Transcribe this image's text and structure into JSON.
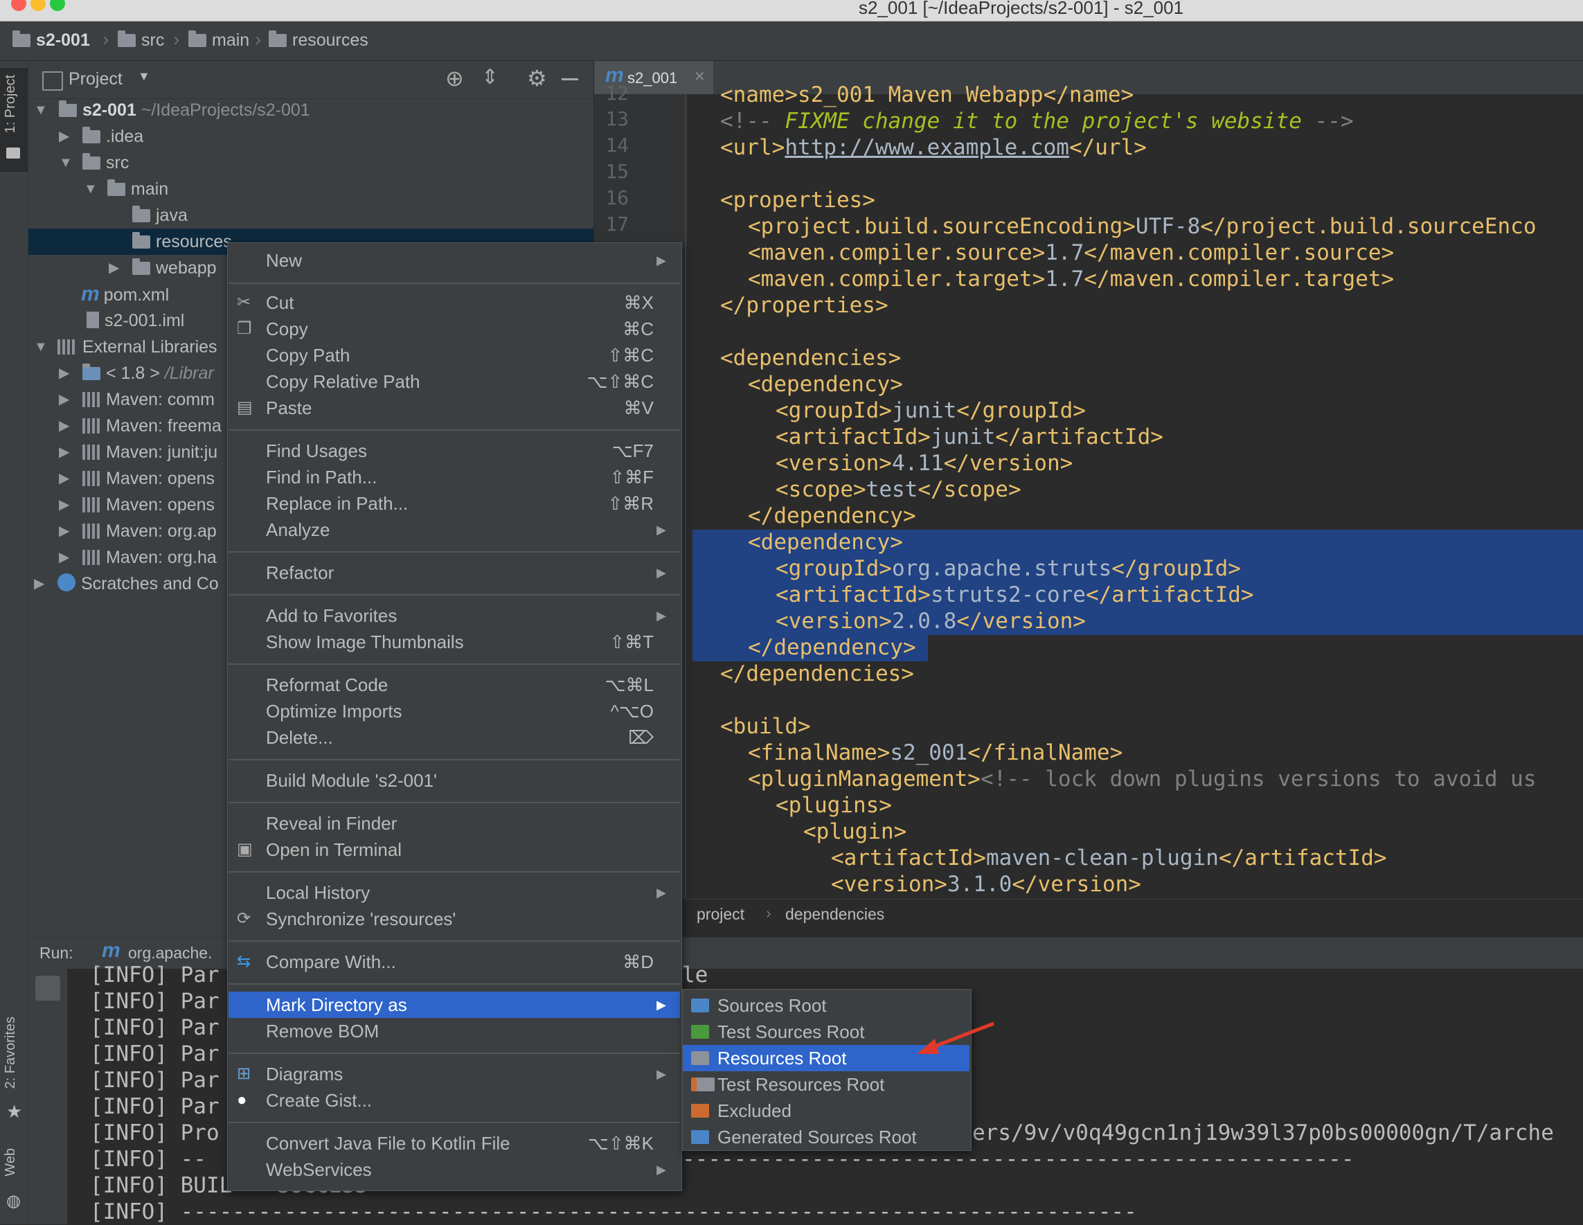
{
  "window": {
    "title": "s2_001 [~/IdeaProjects/s2-001] - s2_001"
  },
  "navbar": {
    "crumbs": [
      "s2-001",
      "src",
      "main",
      "resources"
    ]
  },
  "left_stripe": {
    "project_tab": "1: Project",
    "favorites_tab": "2: Favorites",
    "web_tab": "Web"
  },
  "project_panel": {
    "title": "Project",
    "tree": [
      {
        "label": "s2-001",
        "hint": "~/IdeaProjects/s2-001"
      },
      {
        "label": ".idea"
      },
      {
        "label": "src"
      },
      {
        "label": "main"
      },
      {
        "label": "java"
      },
      {
        "label": "resources"
      },
      {
        "label": "webapp"
      },
      {
        "label": "pom.xml"
      },
      {
        "label": "s2-001.iml"
      },
      {
        "label": "External Libraries"
      },
      {
        "label": "< 1.8 >",
        "hint": "/Librar"
      },
      {
        "label": "Maven: comm"
      },
      {
        "label": "Maven: freema"
      },
      {
        "label": "Maven: junit:ju"
      },
      {
        "label": "Maven: opens"
      },
      {
        "label": "Maven: opens"
      },
      {
        "label": "Maven: org.ap"
      },
      {
        "label": "Maven: org.ha"
      },
      {
        "label": "Scratches and Co"
      }
    ]
  },
  "editor": {
    "tab_label": "s2_001",
    "line_numbers": [
      "12",
      "13",
      "14",
      "15",
      "16",
      "17"
    ],
    "code_lines": {
      "l0": "<name>s2_001 Maven Webapp</name>",
      "l1_open": "<!-- ",
      "l1_fixme": "FIXME change it to the project's website",
      "l1_close": " -->",
      "l2_open": "<url>",
      "l2_link": "http://www.example.com",
      "l2_close": "</url>",
      "l4": "<properties>",
      "l5_tag": "<project.build.sourceEncoding>",
      "l5_val": "UTF-8",
      "l5_end": "</project.build.sourceEnco",
      "l6_tag": "<maven.compiler.source>",
      "l6_val": "1.7",
      "l6_end": "</maven.compiler.source>",
      "l7_tag": "<maven.compiler.target>",
      "l7_val": "1.7",
      "l7_end": "</maven.compiler.target>",
      "l8": "</properties>",
      "l10": "<dependencies>",
      "l11": "<dependency>",
      "l12_tag": "<groupId>",
      "l12_val": "junit",
      "l12_end": "</groupId>",
      "l13_tag": "<artifactId>",
      "l13_val": "junit",
      "l13_end": "</artifactId>",
      "l14_tag": "<version>",
      "l14_val": "4.11",
      "l14_end": "</version>",
      "l15_tag": "<scope>",
      "l15_val": "test",
      "l15_end": "</scope>",
      "l16": "</dependency>",
      "l17": "<dependency>",
      "l18_tag": "<groupId>",
      "l18_val": "org.apache.struts",
      "l18_end": "</groupId>",
      "l19_tag": "<artifactId>",
      "l19_val": "struts2-core",
      "l19_end": "</artifactId>",
      "l20_tag": "<version>",
      "l20_val": "2.0.8",
      "l20_end": "</version>",
      "l21": "</dependency>",
      "l22": "</dependencies>",
      "l24": "<build>",
      "l25_tag": "<finalName>",
      "l25_val": "s2_001",
      "l25_end": "</finalName>",
      "l26_tag": "<pluginManagement>",
      "l26_comment": "<!-- lock down plugins versions to avoid us",
      "l27": "<plugins>",
      "l28": "<plugin>",
      "l29_tag": "<artifactId>",
      "l29_val": "maven-clean-plugin",
      "l29_end": "</artifactId>",
      "l30_tag": "<version>",
      "l30_val": "3.1.0",
      "l30_end": "</version>"
    },
    "breadcrumb": [
      "project",
      "dependencies"
    ]
  },
  "run_panel": {
    "label": "Run:",
    "config": "org.apache.",
    "output": [
      "[INFO] Par",
      "[INFO] Par",
      "[INFO] Par",
      "[INFO] Par",
      "[INFO] Par",
      "[INFO] Par",
      "[INFO] Pro",
      "[INFO] --",
      "[INFO] BUIL",
      "[INFO] --------------------------------------------------------------------------"
    ],
    "output_tail_1": "le",
    "output_tail_2": "ers/9v/v0q49gcn1nj19w39l37p0bs00000gn/T/arche",
    "output_tail_3": "----------------------------------------------------",
    "output_tail_4": "SUCCESS"
  },
  "context_menu": {
    "items": [
      {
        "label": "New",
        "submenu": true
      },
      {
        "label": "Cut",
        "shortcut": "⌘X",
        "icon": "scissors-icon"
      },
      {
        "label": "Copy",
        "shortcut": "⌘C",
        "icon": "copy-icon"
      },
      {
        "label": "Copy Path",
        "shortcut": "⇧⌘C"
      },
      {
        "label": "Copy Relative Path",
        "shortcut": "⌥⇧⌘C"
      },
      {
        "label": "Paste",
        "shortcut": "⌘V",
        "icon": "paste-icon"
      },
      {
        "label": "Find Usages",
        "shortcut": "⌥F7"
      },
      {
        "label": "Find in Path...",
        "shortcut": "⇧⌘F"
      },
      {
        "label": "Replace in Path...",
        "shortcut": "⇧⌘R"
      },
      {
        "label": "Analyze",
        "submenu": true
      },
      {
        "label": "Refactor",
        "submenu": true
      },
      {
        "label": "Add to Favorites",
        "submenu": true
      },
      {
        "label": "Show Image Thumbnails",
        "shortcut": "⇧⌘T"
      },
      {
        "label": "Reformat Code",
        "shortcut": "⌥⌘L"
      },
      {
        "label": "Optimize Imports",
        "shortcut": "^⌥O"
      },
      {
        "label": "Delete...",
        "shortcut": "⌦"
      },
      {
        "label": "Build Module 's2-001'"
      },
      {
        "label": "Reveal in Finder"
      },
      {
        "label": "Open in Terminal",
        "icon": "terminal-icon"
      },
      {
        "label": "Local History",
        "submenu": true
      },
      {
        "label": "Synchronize 'resources'",
        "icon": "sync-icon"
      },
      {
        "label": "Compare With...",
        "shortcut": "⌘D",
        "icon": "compare-icon"
      },
      {
        "label": "Mark Directory as",
        "submenu": true,
        "highlighted": true
      },
      {
        "label": "Remove BOM"
      },
      {
        "label": "Diagrams",
        "submenu": true,
        "icon": "diagram-icon"
      },
      {
        "label": "Create Gist...",
        "icon": "github-icon"
      },
      {
        "label": "Convert Java File to Kotlin File",
        "shortcut": "⌥⇧⌘K"
      },
      {
        "label": "WebServices",
        "submenu": true
      }
    ]
  },
  "submenu": {
    "items": [
      {
        "label": "Sources Root",
        "color": "#4a86c7"
      },
      {
        "label": "Test Sources Root",
        "color": "#4a9a3d"
      },
      {
        "label": "Resources Root",
        "color": "#8d9199",
        "highlighted": true
      },
      {
        "label": "Test Resources Root",
        "color": "#8d9199"
      },
      {
        "label": "Excluded",
        "color": "#cc6a2f"
      },
      {
        "label": "Generated Sources Root",
        "color": "#4a86c7"
      }
    ]
  },
  "colors": {
    "accent": "#2f65ca",
    "selection": "#214283",
    "arrow": "#e03a2a"
  }
}
